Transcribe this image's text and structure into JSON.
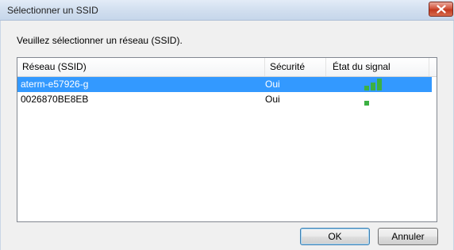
{
  "window": {
    "title": "Sélectionner un SSID",
    "instruction": "Veuillez sélectionner un réseau (SSID)."
  },
  "list": {
    "columns": [
      "Réseau (SSID)",
      "Sécurité",
      "État du signal"
    ],
    "rows": [
      {
        "ssid": "aterm-e57926-g",
        "security": "Oui",
        "signal_bars": 3,
        "selected": true
      },
      {
        "ssid": "0026870BE8EB",
        "security": "Oui",
        "signal_bars": 1,
        "selected": false
      }
    ]
  },
  "buttons": {
    "ok": "OK",
    "cancel": "Annuler"
  },
  "colors": {
    "selection": "#3399ff",
    "signal": "#3cb043",
    "close_button": "#c9432a"
  }
}
